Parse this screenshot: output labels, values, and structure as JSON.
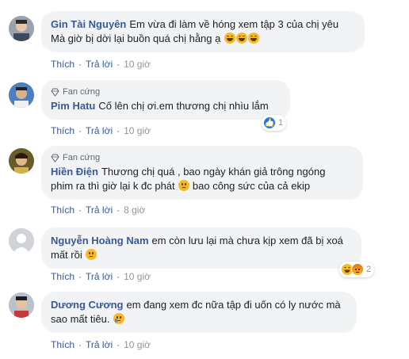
{
  "comments": [
    {
      "author": "Gin Tài Nguyên",
      "badge": "",
      "text_line1": "Em vừa đi làm về hóng xem tập 3 của chị yêu",
      "text_line2": "Mà giờ bị dời lại buồn quá chị hằng ạ",
      "emojis": [
        "laugh",
        "laugh",
        "laugh"
      ],
      "like": "Thích",
      "reply": "Trả lời",
      "time": "10 giờ",
      "reactions": null
    },
    {
      "author": "Pim Hatu",
      "badge": "Fan cứng",
      "text_line1": "Cố lên chị ơi.em thương chị nhìu lắm",
      "like": "Thích",
      "reply": "Trả lời",
      "time": "10 giờ",
      "reactions": {
        "count": "1",
        "types": [
          "like"
        ]
      }
    },
    {
      "author": "Hiền Điện",
      "badge": "Fan cứng",
      "text_line1": "Thương chị quá , bao ngày khán giả trông ngóng",
      "text_line2a": "phim ra thì giờ lại k đc phát",
      "text_line2b": "bao công sức của cả ekip",
      "like": "Thích",
      "reply": "Trả lời",
      "time": "8 giờ",
      "reactions": null
    },
    {
      "author": "Nguyễn Hoàng Nam",
      "badge": "",
      "text_line1": "em còn lưu lại mà chưa kịp xem đã bị xoá",
      "text_line2": "mất rồi",
      "like": "Thích",
      "reply": "Trả lời",
      "time": "10 giờ",
      "reactions": {
        "count": "2",
        "types": [
          "haha",
          "angry"
        ]
      }
    },
    {
      "author": "Dương Cương",
      "badge": "",
      "text_line1": "em đang xem đc nữa tập đi uốn có ly nước mà",
      "text_line2": "sao mất tiêu.",
      "like": "Thích",
      "reply": "Trả lời",
      "time": "10 giờ",
      "reactions": null
    }
  ],
  "separator": "·"
}
